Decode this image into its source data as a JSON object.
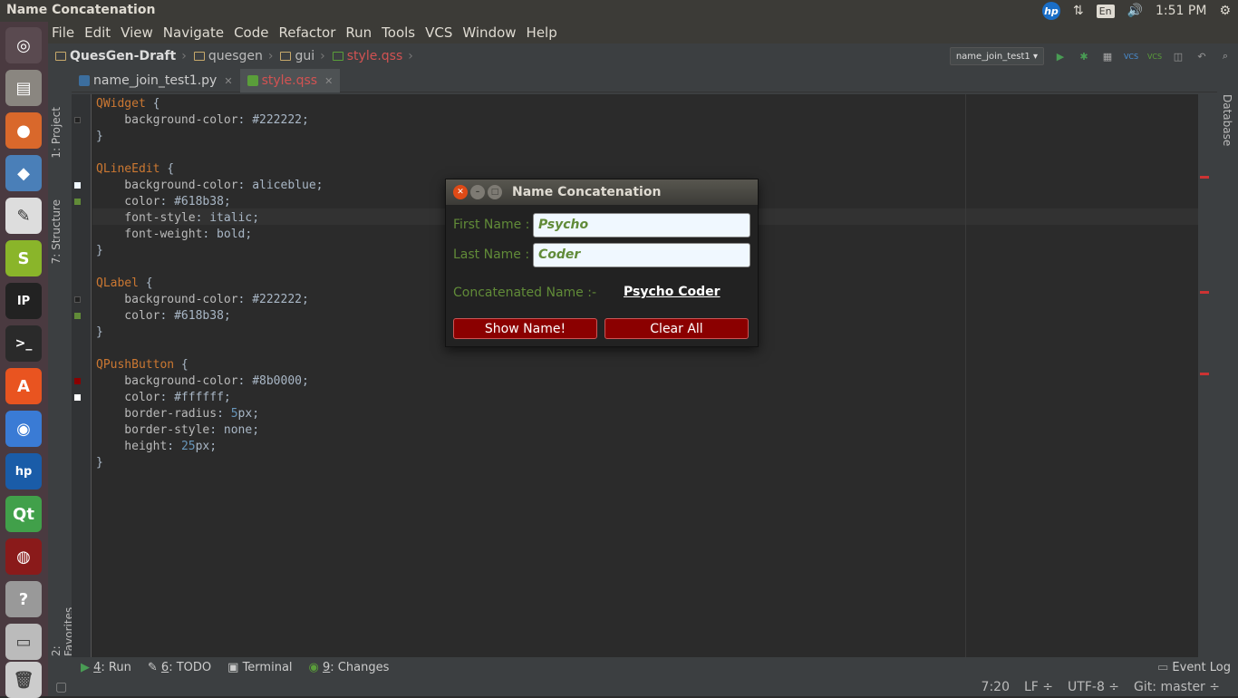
{
  "window": {
    "title": "Name Concatenation"
  },
  "tray": {
    "hp": "hp",
    "lang": "En",
    "time": "1:51 PM"
  },
  "menu": [
    "File",
    "Edit",
    "View",
    "Navigate",
    "Code",
    "Refactor",
    "Run",
    "Tools",
    "VCS",
    "Window",
    "Help"
  ],
  "breadcrumb": [
    "QuesGen-Draft",
    "quesgen",
    "gui",
    "style.qss"
  ],
  "run_config": "name_join_test1",
  "tabs": [
    {
      "label": "name_join_test1.py",
      "active": false
    },
    {
      "label": "style.qss",
      "active": true
    }
  ],
  "side_left": {
    "project": "1: Project",
    "structure": "7: Structure",
    "favorites": "2: Favorites"
  },
  "side_right": {
    "database": "Database"
  },
  "code": [
    [
      [
        "sel",
        "QWidget"
      ],
      [
        "txt",
        " {"
      ]
    ],
    [
      [
        "prop",
        "    background-color"
      ],
      [
        "txt",
        ": #222222;"
      ]
    ],
    [
      [
        "txt",
        "}"
      ]
    ],
    [
      [
        "txt",
        ""
      ]
    ],
    [
      [
        "sel",
        "QLineEdit"
      ],
      [
        "txt",
        " {"
      ]
    ],
    [
      [
        "prop",
        "    background-color"
      ],
      [
        "txt",
        ": aliceblue;"
      ]
    ],
    [
      [
        "prop",
        "    color"
      ],
      [
        "txt",
        ": #618b38;"
      ]
    ],
    [
      [
        "prop",
        "    font-style"
      ],
      [
        "txt",
        ": italic;"
      ]
    ],
    [
      [
        "prop",
        "    font-weight"
      ],
      [
        "txt",
        ": bold;"
      ]
    ],
    [
      [
        "txt",
        "}"
      ]
    ],
    [
      [
        "txt",
        ""
      ]
    ],
    [
      [
        "sel",
        "QLabel"
      ],
      [
        "txt",
        " {"
      ]
    ],
    [
      [
        "prop",
        "    background-color"
      ],
      [
        "txt",
        ": #222222;"
      ]
    ],
    [
      [
        "prop",
        "    color"
      ],
      [
        "txt",
        ": #618b38;"
      ]
    ],
    [
      [
        "txt",
        "}"
      ]
    ],
    [
      [
        "txt",
        ""
      ]
    ],
    [
      [
        "sel",
        "QPushButton"
      ],
      [
        "txt",
        " {"
      ]
    ],
    [
      [
        "prop",
        "    background-color"
      ],
      [
        "txt",
        ": #8b0000;"
      ]
    ],
    [
      [
        "prop",
        "    color"
      ],
      [
        "txt",
        ": #ffffff;"
      ]
    ],
    [
      [
        "prop",
        "    border-radius"
      ],
      [
        "txt",
        ": "
      ],
      [
        "num",
        "5"
      ],
      [
        "txt",
        "px;"
      ]
    ],
    [
      [
        "prop",
        "    border-style"
      ],
      [
        "txt",
        ": none;"
      ]
    ],
    [
      [
        "prop",
        "    height"
      ],
      [
        "txt",
        ": "
      ],
      [
        "num",
        "25"
      ],
      [
        "txt",
        "px;"
      ]
    ],
    [
      [
        "txt",
        "}"
      ]
    ]
  ],
  "bottom_tabs": [
    {
      "num": "4",
      "label": ": Run"
    },
    {
      "num": "6",
      "label": ": TODO"
    },
    {
      "num": "",
      "label": "Terminal"
    },
    {
      "num": "9",
      "label": ": Changes"
    }
  ],
  "event_log": "Event Log",
  "status": {
    "position": "7:20",
    "line_sep": "LF ÷",
    "encoding": "UTF-8 ÷",
    "git": "Git: master ÷"
  },
  "dialog": {
    "title": "Name Concatenation",
    "first_label": "First Name :",
    "first_value": "Psycho",
    "last_label": "Last Name :",
    "last_value": "Coder",
    "concat_label": "Concatenated Name :-",
    "concat_value": "Psycho Coder",
    "show_button": "Show Name!",
    "clear_button": "Clear All"
  },
  "colors": {
    "accent_green": "#618b38",
    "button_red": "#8b0000",
    "bg_dark": "#222222"
  }
}
